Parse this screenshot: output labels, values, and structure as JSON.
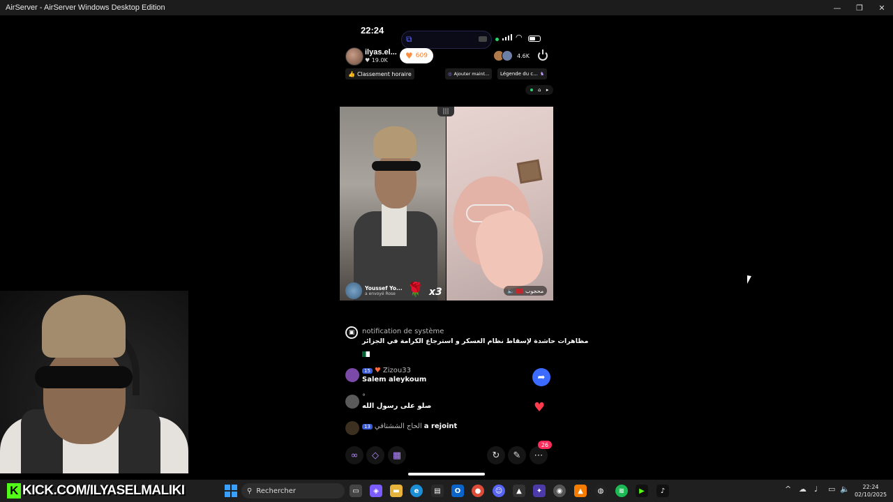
{
  "window": {
    "title": "AirServer - AirServer Windows Desktop Edition",
    "minimize": "—",
    "maximize": "❐",
    "close": "✕"
  },
  "phone": {
    "time": "22:24",
    "host": {
      "name": "ilyas.el...",
      "likes": "19.0K",
      "hearts": "609"
    },
    "viewer_count": "4.6K",
    "tags": {
      "hourly": "Classement horaire",
      "add": "Ajouter maint...",
      "legend": "Légende du c..."
    },
    "split_handle": "|||",
    "gift": {
      "sender": "Youssef Yo...",
      "sub": "a envoyé  Rose",
      "multiplier": "x3"
    },
    "right_label": "محجوب",
    "chat": {
      "system_title": "notification de système",
      "system_text": "مظاهرات حاشدة لإسقاط نظام العسكر و استرجاع الكرامة في الجزائر",
      "msg1": {
        "badge": "15",
        "user": "Zizou33",
        "text": "Salem aleykoum"
      },
      "msg2": {
        "user": "°",
        "text": "صلو على رسول الله"
      },
      "msg3": {
        "badge": "13",
        "user": "الحاج الششتافي",
        "text": "a rejoint"
      }
    },
    "bottom_badge": "26"
  },
  "overlay": {
    "kick": "KICK.COM/ILYASELMALIKI",
    "kick_logo": "K"
  },
  "taskbar": {
    "search_placeholder": "Rechercher",
    "time": "22:24",
    "date": "02/10/2025"
  }
}
